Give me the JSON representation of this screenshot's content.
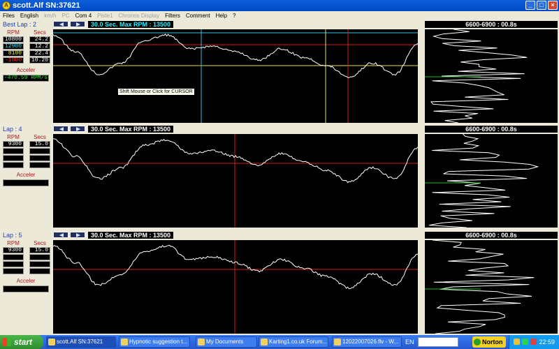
{
  "window": {
    "title": "scott.Alf   SN:37621",
    "buttons": [
      "_",
      "□",
      "×"
    ]
  },
  "menu": [
    {
      "label": "Files",
      "disabled": false
    },
    {
      "label": "English",
      "disabled": false
    },
    {
      "label": "km/h",
      "disabled": true
    },
    {
      "label": "PC",
      "disabled": true
    },
    {
      "label": "Com 4",
      "disabled": false
    },
    {
      "label": "Piste1",
      "disabled": true
    },
    {
      "label": "Chronos Display",
      "disabled": true
    },
    {
      "label": "Filters",
      "disabled": false
    },
    {
      "label": "Comment",
      "disabled": false
    },
    {
      "label": "Help",
      "disabled": false
    },
    {
      "label": "?",
      "disabled": false
    }
  ],
  "laps": [
    {
      "label": "Best Lap : 2",
      "info": "30.0 Sec.  Max RPM : 13500",
      "hist_header": "6600-6900 : 00.8s",
      "rpm_header": "RPM",
      "secs_header": "Secs",
      "rpm_values": [
        "10800",
        "12900",
        "8100",
        "-1800"
      ],
      "secs_values": [
        "24.2",
        "12.2",
        "22.4",
        "10.20"
      ],
      "accel_header": "Acceler",
      "accel_value": "-470.59 RPM/s",
      "tooltip": "Shift Mouse or Click for CURSOR"
    },
    {
      "label": "Lap : 4",
      "info": "30.0 Sec.  Max RPM : 13500",
      "hist_header": "6600-6900 : 00.8s",
      "rpm_header": "RPM",
      "secs_header": "Secs",
      "rpm_values": [
        "9300",
        "",
        "",
        ""
      ],
      "secs_values": [
        "15.0",
        "",
        "",
        ""
      ],
      "accel_header": "Acceler",
      "accel_value": ""
    },
    {
      "label": "Lap : 5",
      "info": "30.0 Sec.  Max RPM : 13500",
      "hist_header": "6600-6900 : 00.8s",
      "rpm_header": "RPM",
      "secs_header": "Secs",
      "rpm_values": [
        "9300",
        "",
        "",
        ""
      ],
      "secs_values": [
        "15.0",
        "",
        "",
        ""
      ],
      "accel_header": "Acceler",
      "accel_value": ""
    }
  ],
  "colors": {
    "rpm_value_colors": [
      "#ffffff",
      "#30e0ff",
      "#f0f030",
      "#ff3030"
    ],
    "trace": "#ffffff",
    "cursor_red": "#d02020",
    "cursor_cyan": "#30c0e0",
    "cursor_yellow": "#e0e050",
    "hist_marker": "#20c020"
  },
  "taskbar": {
    "start_label": "start",
    "tasks": [
      {
        "label": "scott.Alf  SN:37621",
        "active": true
      },
      {
        "label": "Hypnotic suggestion t...",
        "active": false
      },
      {
        "label": "My Documents",
        "active": false
      },
      {
        "label": "Karting1.co.uk Forum...",
        "active": false
      },
      {
        "label": "12022007026.flv - W...",
        "active": false
      }
    ],
    "language": "EN",
    "norton_label": "Norton",
    "clock": "22:59"
  }
}
